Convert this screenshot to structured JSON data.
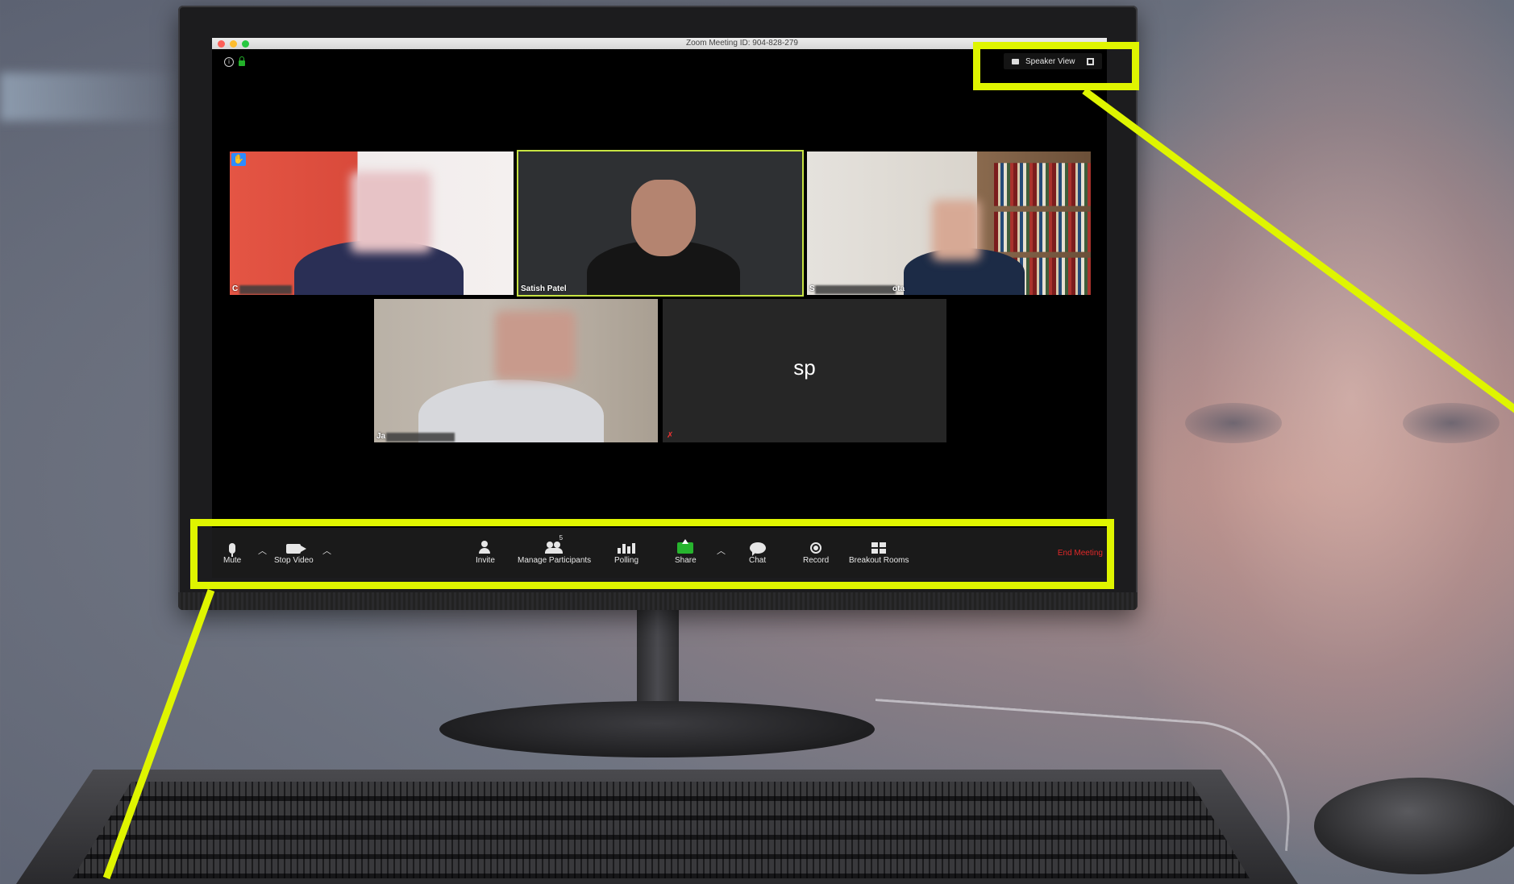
{
  "window": {
    "title": "Zoom Meeting ID: 904-828-279"
  },
  "view_control": {
    "label": "Speaker View"
  },
  "participants": [
    {
      "name": "C",
      "raised_hand": true
    },
    {
      "name": "Satish Patel",
      "active_speaker": true
    },
    {
      "name": "S",
      "name_suffix": "ota"
    },
    {
      "name": "Ja"
    },
    {
      "name": "sp",
      "video_off": true,
      "muted": true
    }
  ],
  "toolbar": {
    "mute": "Mute",
    "stop_video": "Stop Video",
    "invite": "Invite",
    "manage_participants": "Manage Participants",
    "participant_count": "5",
    "polling": "Polling",
    "share": "Share",
    "chat": "Chat",
    "record": "Record",
    "breakout_rooms": "Breakout Rooms",
    "end_meeting": "End Meeting"
  },
  "colors": {
    "highlight": "#dff500",
    "active_speaker_border": "#c7e342",
    "share_green": "#27b42e",
    "end_meeting_red": "#e02828"
  }
}
